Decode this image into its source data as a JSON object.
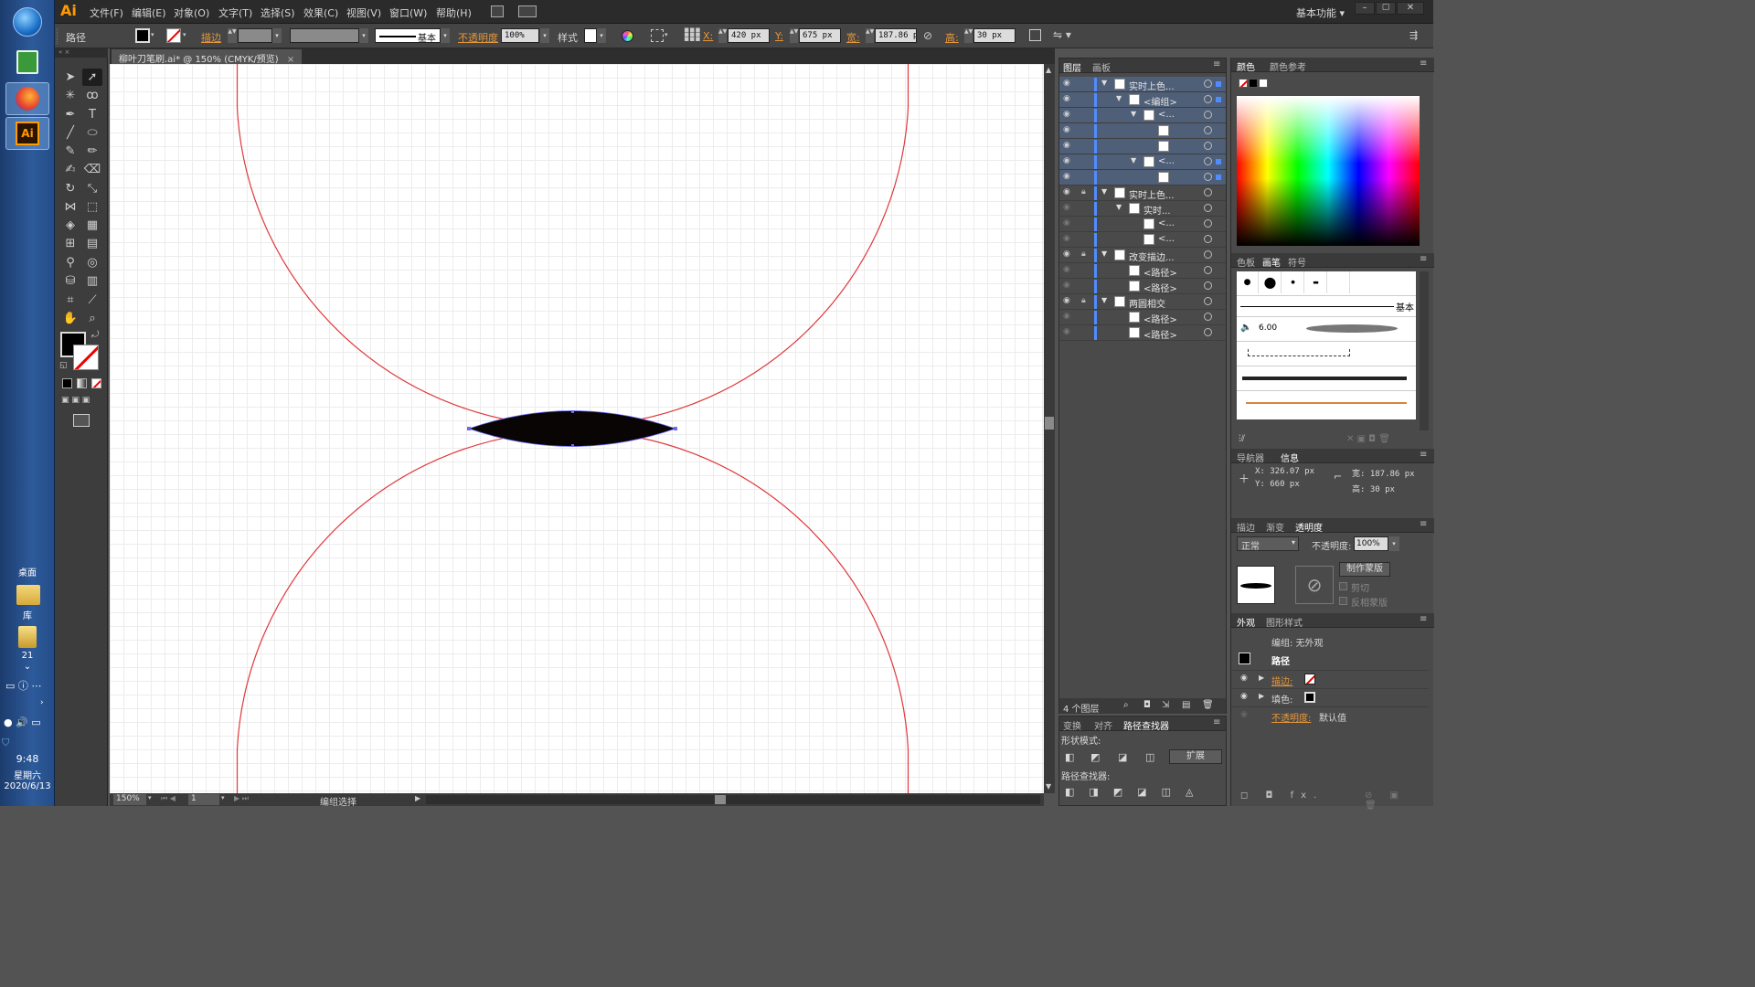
{
  "taskbar": {
    "time": "9:48",
    "weekday": "星期六",
    "date": "2020/6/13",
    "desktop_label": "桌面",
    "library_label": "库",
    "folder_label": "21"
  },
  "app": {
    "logo": "Ai",
    "workspace": "基本功能"
  },
  "menu": [
    "文件(F)",
    "编辑(E)",
    "对象(O)",
    "文字(T)",
    "选择(S)",
    "效果(C)",
    "视图(V)",
    "窗口(W)",
    "帮助(H)"
  ],
  "control": {
    "object_type": "路径",
    "stroke_label": "描边",
    "brush_label": "基本",
    "opacity_label": "不透明度",
    "opacity_value": "100%",
    "style_label": "样式",
    "x_label": "X:",
    "x_value": "420 px",
    "y_label": "Y:",
    "y_value": "675 px",
    "w_label": "宽:",
    "w_value": "187.86 p",
    "h_label": "高:",
    "h_value": "30 px"
  },
  "document": {
    "tab_title": "柳叶刀笔刷.ai* @ 150% (CMYK/预览)",
    "zoom": "150%",
    "artboard": "1",
    "status": "编组选择"
  },
  "layers_panel": {
    "tabs": [
      "图层",
      "画板"
    ],
    "rows": [
      {
        "name": "实时上色...",
        "indent": 0,
        "expanded": true
      },
      {
        "name": "<编组>",
        "indent": 1,
        "expanded": true
      },
      {
        "name": "<...",
        "indent": 2,
        "expanded": true
      },
      {
        "name": "",
        "indent": 3,
        "expanded": false
      },
      {
        "name": "",
        "indent": 3,
        "expanded": false
      },
      {
        "name": "<...",
        "indent": 2,
        "expanded": true
      },
      {
        "name": "",
        "indent": 3,
        "expanded": false
      },
      {
        "name": "实时上色...",
        "indent": 0,
        "expanded": true
      },
      {
        "name": "实时...",
        "indent": 1,
        "expanded": true
      },
      {
        "name": "<...",
        "indent": 2,
        "expanded": false
      },
      {
        "name": "<...",
        "indent": 2,
        "expanded": false
      },
      {
        "name": "改变描边...",
        "indent": 0,
        "expanded": true
      },
      {
        "name": "<路径>",
        "indent": 1,
        "expanded": false
      },
      {
        "name": "<路径>",
        "indent": 1,
        "expanded": false
      },
      {
        "name": "两圆相交",
        "indent": 0,
        "expanded": true
      },
      {
        "name": "<路径>",
        "indent": 1,
        "expanded": false
      },
      {
        "name": "<路径>",
        "indent": 1,
        "expanded": false
      }
    ],
    "layer_count": "4 个图层"
  },
  "pathfinder": {
    "tabs": [
      "变换",
      "对齐",
      "路径查找器"
    ],
    "shape_modes": "形状模式:",
    "expand": "扩展",
    "pathfinders": "路径查找器:"
  },
  "color_panel": {
    "tabs": [
      "颜色",
      "颜色参考"
    ]
  },
  "brush_panel": {
    "tabs": [
      "色板",
      "画笔",
      "符号"
    ],
    "basic_label": "基本",
    "size_value": "6.00"
  },
  "info_panel": {
    "tabs": [
      "导航器",
      "信息"
    ],
    "x": "X: 326.07 px",
    "y": "Y: 660 px",
    "w": "宽: 187.86 px",
    "h": "高: 30 px"
  },
  "transparency_panel": {
    "tabs": [
      "描边",
      "渐变",
      "透明度"
    ],
    "blend_mode": "正常",
    "opacity_label": "不透明度:",
    "opacity_value": "100%",
    "make_mask": "制作蒙版",
    "clip": "剪切",
    "invert": "反相蒙版"
  },
  "appearance_panel": {
    "tabs": [
      "外观",
      "图形样式"
    ],
    "group_line": "编组: 无外观",
    "path_label": "路径",
    "stroke_label": "描边:",
    "fill_label": "填色:",
    "opacity_label": "不透明度:",
    "opacity_value": "默认值"
  },
  "colors": {
    "circle_stroke": "#e0383c",
    "leaf_fill": "#0a0505",
    "anchor": "#6a6aff",
    "accent_orange": "#e5963a"
  }
}
